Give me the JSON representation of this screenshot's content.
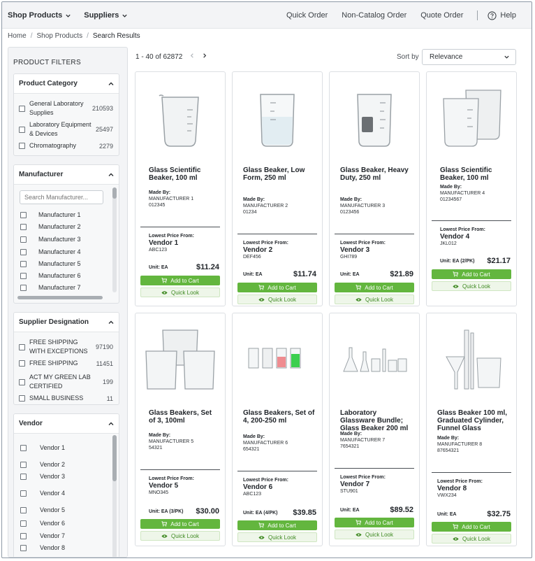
{
  "nav": {
    "shop_products": "Shop Products",
    "suppliers": "Suppliers",
    "quick_order": "Quick Order",
    "non_catalog_order": "Non-Catalog Order",
    "quote_order": "Quote Order",
    "help": "Help"
  },
  "breadcrumb": [
    "Home",
    "Shop Products",
    "Search Results"
  ],
  "results": {
    "count": "1 - 40 of 62872",
    "sort_label": "Sort by",
    "sort_value": "Relevance"
  },
  "filters": {
    "title": "PRODUCT FILTERS",
    "category": {
      "title": "Product Category",
      "items": [
        {
          "label": "General Laboratory Supplies",
          "count": "210593"
        },
        {
          "label": "Laboratory Equipment & Devices",
          "count": "25497"
        },
        {
          "label": "Chromatography",
          "count": "2279"
        }
      ]
    },
    "manufacturer": {
      "title": "Manufacturer",
      "placeholder": "Search Manufacturer...",
      "items": [
        "Manufacturer 1",
        "Manufacturer 2",
        "Manufacturer 3",
        "Manufacturer 4",
        "Manufacturer 5",
        "Manufacturer 6",
        "Manufacturer 7"
      ]
    },
    "supplier": {
      "title": "Supplier Designation",
      "items": [
        {
          "label": "FREE SHIPPING WITH EXCEPTIONS",
          "count": "97190"
        },
        {
          "label": "FREE SHIPPING",
          "count": "11451"
        },
        {
          "label": "ACT MY GREEN LAB CERTIFIED",
          "count": "199"
        },
        {
          "label": "SMALL BUSINESS",
          "count": "11"
        }
      ]
    },
    "vendor": {
      "title": "Vendor",
      "items": [
        "Vendor 1",
        "Vendor 2",
        "Vendor 3",
        "Vendor 4",
        "Vendor 5",
        "Vendor 6",
        "Vendor 7",
        "Vendor 8"
      ]
    }
  },
  "card_labels": {
    "made_by": "Made By:",
    "lowest_price": "Lowest Price From:",
    "add_to_cart": "Add to Cart",
    "quick_look": "Quick Look"
  },
  "products": [
    {
      "name": "Glass Scientific Beaker, 100 ml",
      "mfr": "MANUFACTURER 1",
      "mfr_code": "012345",
      "vendor": "Vendor 1",
      "vendor_code": "ABC123",
      "unit": "Unit: EA",
      "price": "$11.24",
      "image": "beaker-icon"
    },
    {
      "name": "Glass Beaker, Low Form, 250 ml",
      "mfr": "MANUFACTURER 2",
      "mfr_code": "01234",
      "vendor": "Vendor 2",
      "vendor_code": "DEF456",
      "unit": "Unit: EA",
      "price": "$11.74",
      "image": "beaker-water-icon"
    },
    {
      "name": "Glass Beaker, Heavy Duty, 250 ml",
      "mfr": "MANUFACTURER 3",
      "mfr_code": "0123456",
      "vendor": "Vendor 3",
      "vendor_code": "GHI789",
      "unit": "Unit: EA",
      "price": "$21.89",
      "image": "beaker-label-icon"
    },
    {
      "name": "Glass Scientific Beaker, 100 ml",
      "mfr": "MANUFACTURER 4",
      "mfr_code": "01234567",
      "vendor": "Vendor 4",
      "vendor_code": "JKL012",
      "unit": "Unit: EA (2/PK)",
      "price": "$21.17",
      "image": "beaker-pair-icon"
    },
    {
      "name": "Glass Beakers, Set of 3, 100ml",
      "mfr": "MANUFACTURER 5",
      "mfr_code": "54321",
      "vendor": "Vendor 5",
      "vendor_code": "MNO345",
      "unit": "Unit: EA (3/PK)",
      "price": "$30.00",
      "image": "beaker-set-icon"
    },
    {
      "name": "Glass Beakers, Set of 4, 200-250 ml",
      "mfr": "MANUFACTURER 6",
      "mfr_code": "654321",
      "vendor": "Vendor 6",
      "vendor_code": "ABC123",
      "unit": "Unit: EA (4/PK)",
      "price": "$39.85",
      "image": "beaker-colored-set-icon"
    },
    {
      "name": "Laboratory Glassware Bundle; Glass Beaker 200 ml",
      "mfr": "MANUFACTURER 7",
      "mfr_code": "7654321",
      "vendor": "Vendor 7",
      "vendor_code": "STU901",
      "unit": "Unit: EA",
      "price": "$89.52",
      "image": "glassware-bundle-icon"
    },
    {
      "name": "Glass Beaker 100 ml, Graduated Cylinder, Funnel Glass",
      "mfr": "MANUFACTURER 8",
      "mfr_code": "87654321",
      "vendor": "Vendor 8",
      "vendor_code": "VWX234",
      "unit": "Unit: EA",
      "price": "$32.75",
      "image": "beaker-cylinder-funnel-icon"
    }
  ]
}
